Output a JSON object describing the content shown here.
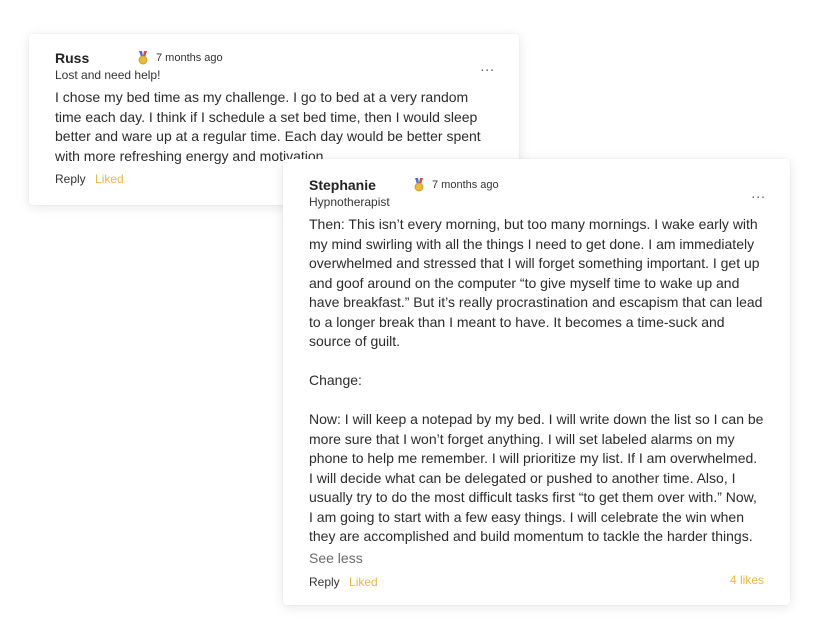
{
  "comments": [
    {
      "author": "Russ",
      "time": "7 months ago",
      "role": "Lost and need help!",
      "paragraphs": [
        "I chose my bed time as my challenge. I go to bed at a very random time each day. I think if I schedule a set bed time, then I would sleep better and ware up at a regular time. Each day would be better spent with more refreshing energy and motivation."
      ],
      "reply_label": "Reply",
      "liked_label": "Liked",
      "badge_icon": "medal-icon"
    },
    {
      "author": "Stephanie",
      "time": "7 months ago",
      "role": "Hypnotherapist",
      "paragraphs": [
        "Then: This isn’t every morning, but too many mornings. I wake early with my mind swirling with all the things I need to get done. I am immediately overwhelmed and stressed that I will forget something important. I get up and goof around on the computer “to give myself time to wake up and have breakfast.” But it’s really procrastination and escapism that can lead to a longer break than I meant to have. It becomes a time-suck and source of guilt.",
        "Change:",
        "Now: I will keep a notepad by my bed. I will write down the list so I can be more sure that I won’t forget anything. I will set labeled alarms on my phone to help me remember. I will prioritize my list. If I am overwhelmed. I will decide what can be delegated or pushed to another time. Also, I usually try to do the most difficult tasks first “to get them over with.” Now, I am going to start with a few easy things. I will celebrate the win when they are accomplished and build momentum to tackle the harder things."
      ],
      "see_less_label": "See less",
      "reply_label": "Reply",
      "liked_label": "Liked",
      "likes_count": "4 likes",
      "badge_icon": "medal-icon"
    }
  ],
  "more_label": "...",
  "colors": {
    "accent": "#e7b93c",
    "text": "#2b2b2b"
  }
}
